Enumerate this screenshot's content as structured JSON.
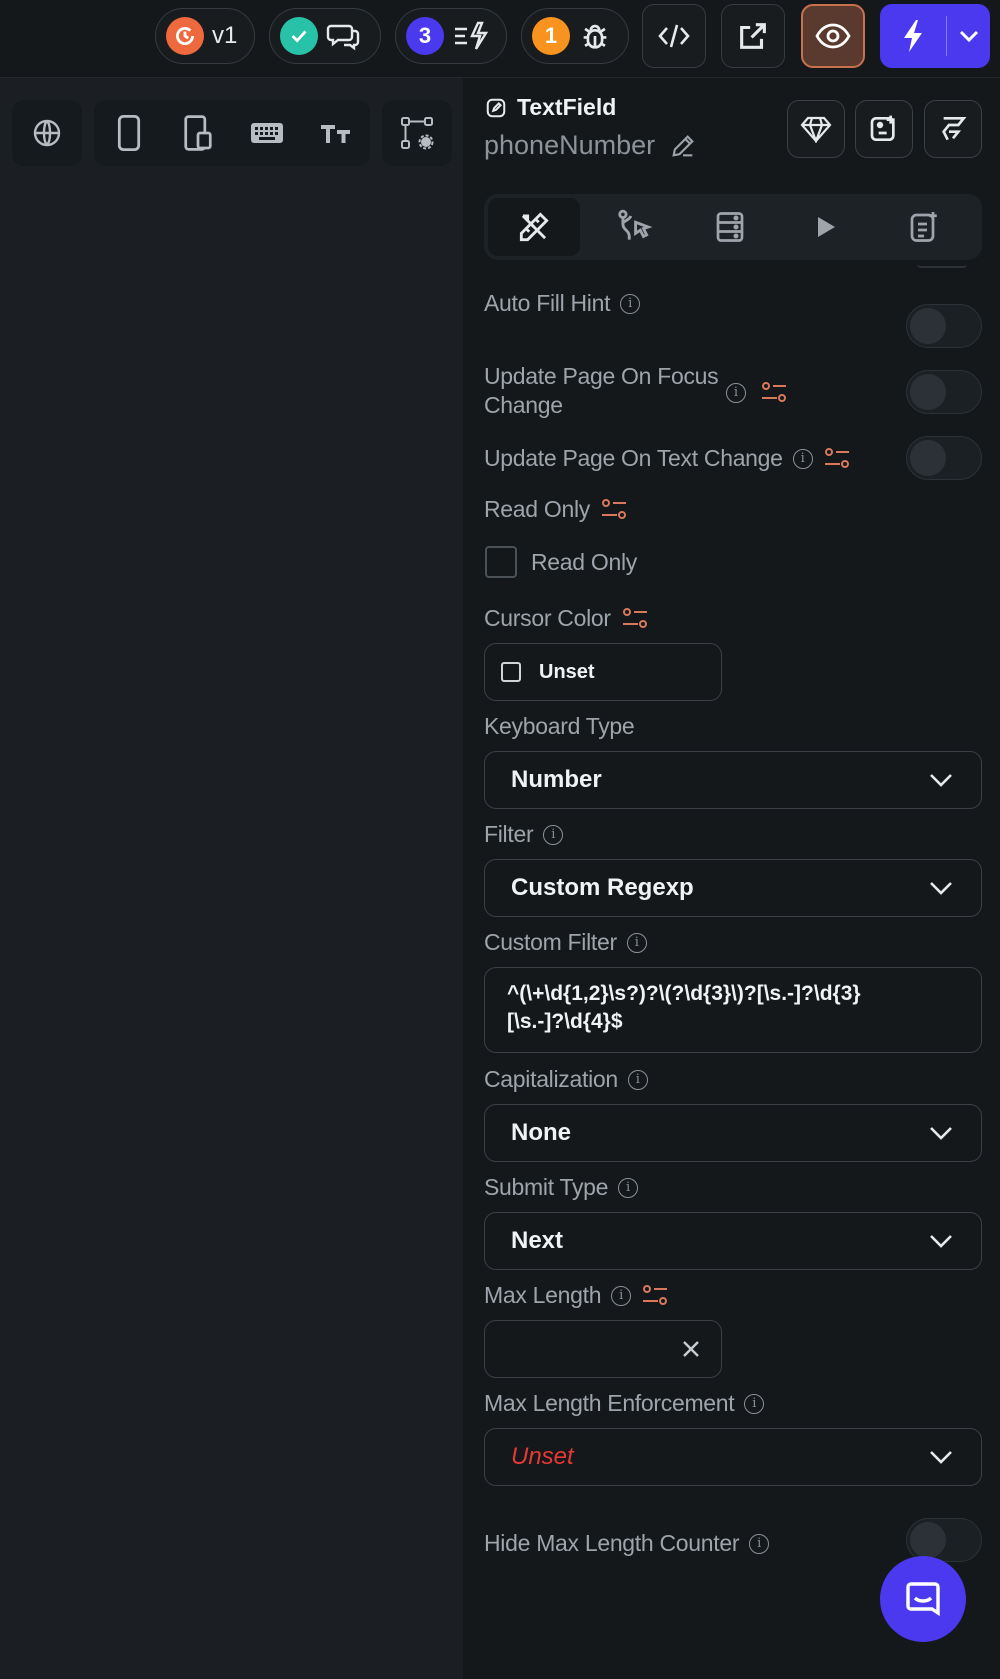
{
  "topbar": {
    "version_label": "v1",
    "warnings_count": "3",
    "bugs_count": "1"
  },
  "widget": {
    "type": "TextField",
    "name": "phoneNumber"
  },
  "props": {
    "auto_fill_hint": "Auto Fill Hint",
    "update_on_focus_line1": "Update Page On Focus",
    "update_on_focus_line2": "Change",
    "update_on_text": "Update Page On Text Change",
    "read_only_label": "Read Only",
    "read_only_checkbox": "Read Only",
    "cursor_color_label": "Cursor Color",
    "cursor_color_value": "Unset",
    "keyboard_type_label": "Keyboard Type",
    "keyboard_type_value": "Number",
    "filter_label": "Filter",
    "filter_value": "Custom Regexp",
    "custom_filter_label": "Custom Filter",
    "custom_filter_line1": "^(\\+\\d{1,2}\\s?)?\\(?\\d{3}\\)?[\\s.-]?\\d{3}",
    "custom_filter_line2": "[\\s.-]?\\d{4}$",
    "capitalization_label": "Capitalization",
    "capitalization_value": "None",
    "submit_type_label": "Submit Type",
    "submit_type_value": "Next",
    "max_length_label": "Max Length",
    "max_length_enforcement_label": "Max Length Enforcement",
    "max_length_enforcement_value": "Unset",
    "hide_counter_label": "Hide Max Length Counter"
  },
  "colors": {
    "accent": "#4b39ef",
    "warning_orange": "#f7931e",
    "success": "#27c2a8",
    "variable_icon": "#d9795c",
    "unset_red": "#e53935"
  }
}
